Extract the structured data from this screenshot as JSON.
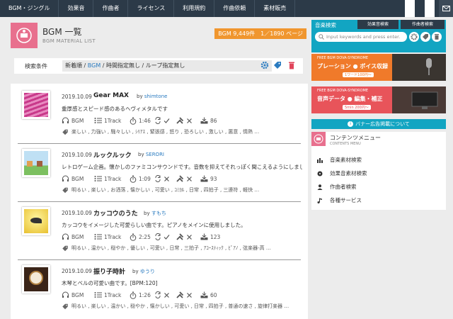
{
  "nav": {
    "items": [
      "BGM・ジングル",
      "効果音",
      "作曲者",
      "ライセンス",
      "利用規約",
      "作曲依頼",
      "素材販売"
    ],
    "mail_icon": "mail-icon"
  },
  "header": {
    "title": "BGM 一覧",
    "subtitle": "BGM MATERIAL LIST",
    "count": "BGM 9,449件　1／1890 ページ"
  },
  "conditions": {
    "label": "検索条件",
    "prefix": "新着順 / ",
    "bgm_link": "BGM",
    "suffix": " / 時間指定無し / ループ指定無し"
  },
  "items": [
    {
      "date": "2019.10.09",
      "title": "Gear MAX",
      "by_label": "by",
      "author": "shimtone",
      "desc": "重厚感とスピード感のあるヘヴィメタルです",
      "type": "BGM",
      "tracks": "1Track",
      "duration": "1:46",
      "downloads": "86",
      "tags": "楽しい , 力強い , 騒々しい , ｼﾘｱｽ , 緊張感 , 怒り , 恐ろしい , 激しい , 悪意 , 情熱 …"
    },
    {
      "date": "2019.10.09",
      "title": "ルックルック",
      "by_label": "by",
      "author": "SERORI",
      "desc": "レトロゲーム企画。懐かしのファミコンサウンドです。音数を抑えてそれっぽく聞こえるようにしまし...",
      "type": "BGM",
      "tracks": "1Track",
      "duration": "1:09",
      "downloads": "93",
      "tags": "明るい , 楽しい , お洒落 , 懐かしい , 可愛い , ｺﾐｶﾙ , 日常 , 四拍子 , 三連符 , 軽快 …"
    },
    {
      "date": "2019.10.09",
      "title": "カッコウのうた",
      "by_label": "by",
      "author": "すもち",
      "desc": "カッコウをイメージした可愛らしい曲です。ピアノをメインに使用しました。",
      "type": "BGM",
      "tracks": "1Track",
      "duration": "2:25",
      "downloads": "123",
      "tags": "明るい , 温かい , 穏やか , 優しい , 可愛い , 日常 , 三拍子 , ｱｺｰｽﾃｨｯｸ , ﾋﾟｱﾉ , 弦楽器-高 …"
    },
    {
      "date": "2019.10.09",
      "title": "振り子時計",
      "by_label": "by",
      "author": "ゆうり",
      "desc": "木琴とベルの可愛い曲です。[BPM:120]",
      "type": "BGM",
      "tracks": "1Track",
      "duration": "1:26",
      "downloads": "60",
      "tags": "明るい , 楽しい , 温かい , 穏やか , 懐かしい , 可愛い , 日常 , 四拍子 , 普通の速さ , 旋律打楽器 …"
    }
  ],
  "sidebar": {
    "search": {
      "title": "音楽検索",
      "tab2": "効果音検索",
      "tab3": "作曲者検索",
      "placeholder": "Input keywords and press enter."
    },
    "banner1": {
      "top": "FREE BGM DOVA-SYNDROME",
      "main": "プレーション ● ボイス収録",
      "sub": "1ワード100円〜"
    },
    "banner2": {
      "top": "FREE BGM DOVA-SYNDROME",
      "main": "音声データ ● 編集・補正",
      "sub": "5min 200円〜"
    },
    "ad_link": "バナー広告掲載について",
    "menu": {
      "title": "コンテンツメニュー",
      "subtitle": "CONTENTS MENU",
      "items": [
        "音楽素材検索",
        "効果音素材検索",
        "作曲者検索",
        "各種サービス"
      ]
    }
  },
  "colors": {
    "accent": "#12a5c2",
    "nav": "#2c3a48",
    "pink": "#e8708e",
    "orange": "#f0962e",
    "banner1": "#f07a2a",
    "banner2": "#e8545a"
  }
}
